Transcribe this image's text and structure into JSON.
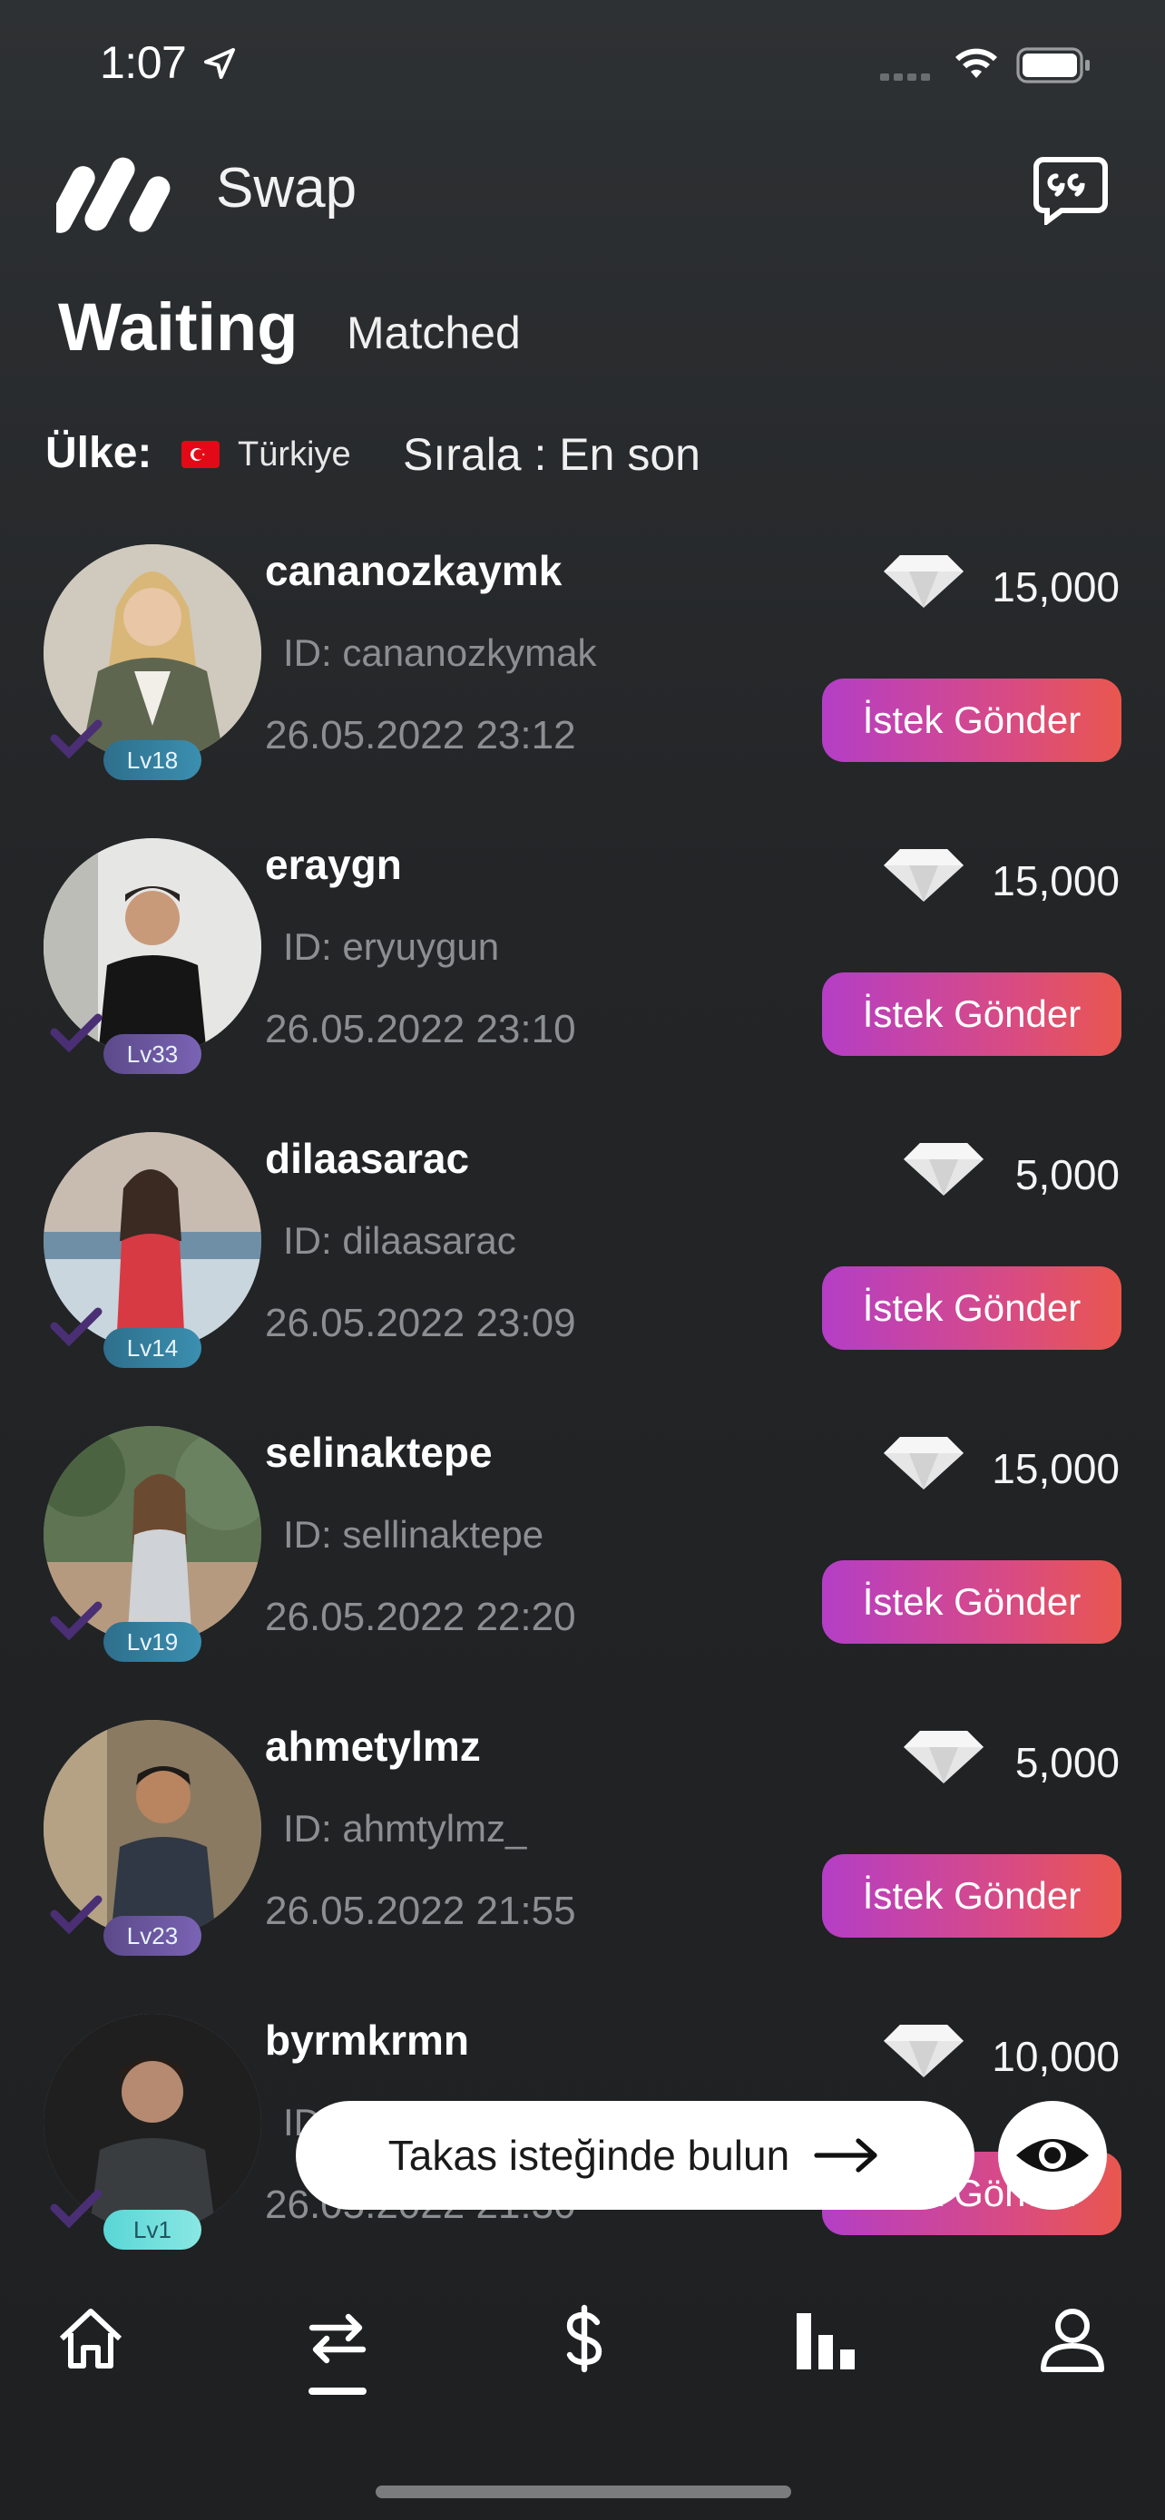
{
  "status_bar": {
    "time": "1:07"
  },
  "header": {
    "app_title": "Swap"
  },
  "tabs": {
    "active": "Waiting",
    "inactive": "Matched"
  },
  "filters": {
    "country_label": "Ülke:",
    "country_value": "Türkiye",
    "sort": "Sırala : En son"
  },
  "request_label": "İstek Gönder",
  "rows": [
    {
      "username": "cananozkaymk",
      "id": "ID: cananozkymak",
      "date": "26.05.2022 23:12",
      "level": "Lv18",
      "amount": "15,000"
    },
    {
      "username": "eraygn",
      "id": "ID: eryuygun",
      "date": "26.05.2022 23:10",
      "level": "Lv33",
      "amount": "15,000"
    },
    {
      "username": "dilaasarac",
      "id": "ID: dilaasarac",
      "date": "26.05.2022 23:09",
      "level": "Lv14",
      "amount": "5,000"
    },
    {
      "username": "selinaktepe",
      "id": "ID: sellinaktepe",
      "date": "26.05.2022 22:20",
      "level": "Lv19",
      "amount": "15,000"
    },
    {
      "username": "ahmetylmz",
      "id": "ID: ahmtylmz_",
      "date": "26.05.2022 21:55",
      "level": "Lv23",
      "amount": "5,000"
    },
    {
      "username": "byrmkrmn",
      "id": "ID",
      "date": "26.05.2022 21:30",
      "level": "Lv1",
      "amount": "10,000"
    }
  ],
  "float_button": {
    "label": "Takas isteğinde bulun"
  },
  "icons": {
    "tabbar": [
      "home-icon",
      "swap-icon",
      "dollar-icon",
      "stats-icon",
      "profile-icon"
    ]
  },
  "colors": {
    "accent_start": "#b43ec6",
    "accent_end": "#e9574f",
    "background": "#232527"
  }
}
